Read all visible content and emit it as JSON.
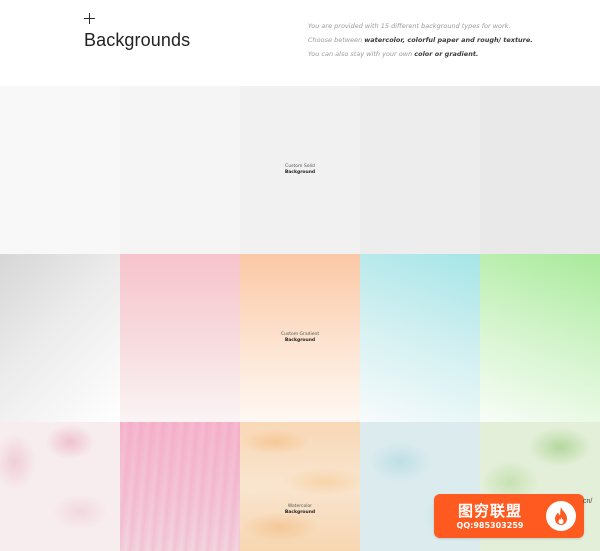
{
  "header": {
    "title": "Backgrounds",
    "description": {
      "line1": "You are provided with 15 different background types for work.",
      "line2_prefix": "Choose between",
      "line2_strong": "watercolor, colorful paper and rough/ texture.",
      "line3_prefix": "You can also stay with your own",
      "line3_strong": "color or gradient."
    }
  },
  "tiles": {
    "solid_label_1": "Custom Solid",
    "solid_label_2": "Background",
    "gradient_label_1": "Custom Gradient",
    "gradient_label_2": "Background",
    "watercolor_label_1": "Watercolor",
    "watercolor_label_2": "Background"
  },
  "watermark": {
    "brand": "图穷联盟",
    "qq": "QQ:985303259",
    "corner": "cn/"
  },
  "colors": {
    "accent": "#ff5a1f"
  }
}
